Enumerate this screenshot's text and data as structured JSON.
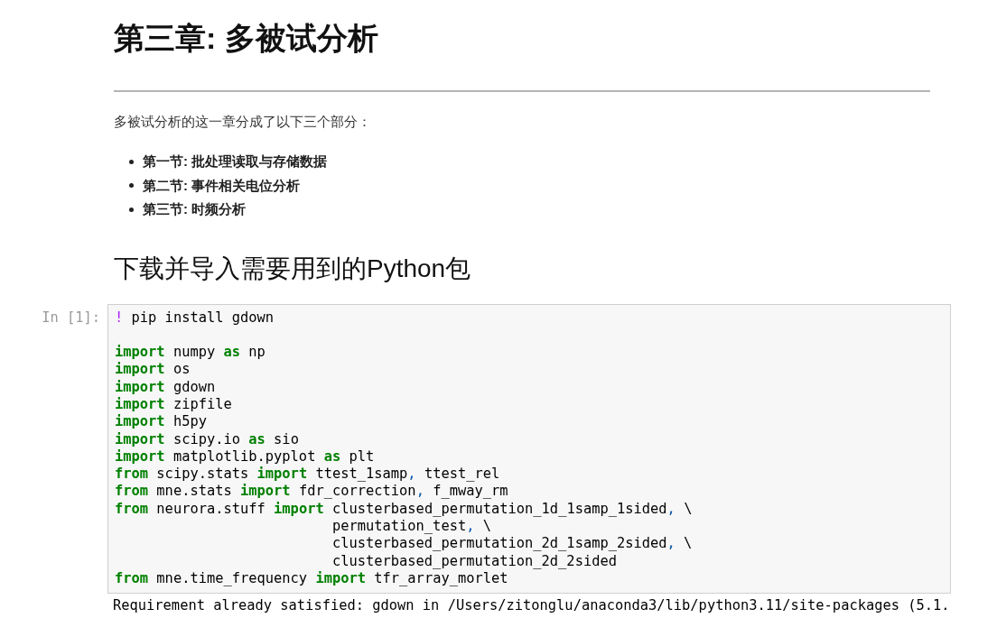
{
  "title": "第三章: 多被试分析",
  "intro": "多被试分析的这一章分成了以下三个部分：",
  "sections": [
    "第一节: 批处理读取与存储数据",
    "第二节: 事件相关电位分析",
    "第三节: 时频分析"
  ],
  "subheading": "下载并导入需要用到的Python包",
  "cell": {
    "prompt": "In [1]:",
    "lines": [
      {
        "kind": "code",
        "tokens": [
          {
            "kind": "magic",
            "text": "!"
          },
          {
            "kind": "name",
            "text": " pip install gdown"
          }
        ]
      },
      {
        "kind": "blank"
      },
      {
        "kind": "code",
        "tokens": [
          {
            "kind": "keyword",
            "text": "import"
          },
          {
            "kind": "name",
            "text": " numpy "
          },
          {
            "kind": "keyword",
            "text": "as"
          },
          {
            "kind": "name",
            "text": " np"
          }
        ]
      },
      {
        "kind": "code",
        "tokens": [
          {
            "kind": "keyword",
            "text": "import"
          },
          {
            "kind": "name",
            "text": " os"
          }
        ]
      },
      {
        "kind": "code",
        "tokens": [
          {
            "kind": "keyword",
            "text": "import"
          },
          {
            "kind": "name",
            "text": " gdown"
          }
        ]
      },
      {
        "kind": "code",
        "tokens": [
          {
            "kind": "keyword",
            "text": "import"
          },
          {
            "kind": "name",
            "text": " zipfile"
          }
        ]
      },
      {
        "kind": "code",
        "tokens": [
          {
            "kind": "keyword",
            "text": "import"
          },
          {
            "kind": "name",
            "text": " h5py"
          }
        ]
      },
      {
        "kind": "code",
        "tokens": [
          {
            "kind": "keyword",
            "text": "import"
          },
          {
            "kind": "name",
            "text": " scipy.io "
          },
          {
            "kind": "keyword",
            "text": "as"
          },
          {
            "kind": "name",
            "text": " sio"
          }
        ]
      },
      {
        "kind": "code",
        "tokens": [
          {
            "kind": "keyword",
            "text": "import"
          },
          {
            "kind": "name",
            "text": " matplotlib.pyplot "
          },
          {
            "kind": "keyword",
            "text": "as"
          },
          {
            "kind": "name",
            "text": " plt"
          }
        ]
      },
      {
        "kind": "code",
        "tokens": [
          {
            "kind": "keyword",
            "text": "from"
          },
          {
            "kind": "name",
            "text": " scipy.stats "
          },
          {
            "kind": "keyword",
            "text": "import"
          },
          {
            "kind": "name",
            "text": " ttest_1samp"
          },
          {
            "kind": "punct",
            "text": ","
          },
          {
            "kind": "name",
            "text": " ttest_rel"
          }
        ]
      },
      {
        "kind": "code",
        "tokens": [
          {
            "kind": "keyword",
            "text": "from"
          },
          {
            "kind": "name",
            "text": " mne.stats "
          },
          {
            "kind": "keyword",
            "text": "import"
          },
          {
            "kind": "name",
            "text": " fdr_correction"
          },
          {
            "kind": "punct",
            "text": ","
          },
          {
            "kind": "name",
            "text": " f_mway_rm"
          }
        ]
      },
      {
        "kind": "code",
        "tokens": [
          {
            "kind": "keyword",
            "text": "from"
          },
          {
            "kind": "name",
            "text": " neurora.stuff "
          },
          {
            "kind": "keyword",
            "text": "import"
          },
          {
            "kind": "name",
            "text": " clusterbased_permutation_1d_1samp_1sided"
          },
          {
            "kind": "punct",
            "text": ","
          },
          {
            "kind": "name",
            "text": " \\"
          }
        ]
      },
      {
        "kind": "code",
        "tokens": [
          {
            "kind": "name",
            "text": "                          permutation_test"
          },
          {
            "kind": "punct",
            "text": ","
          },
          {
            "kind": "name",
            "text": " \\"
          }
        ]
      },
      {
        "kind": "code",
        "tokens": [
          {
            "kind": "name",
            "text": "                          clusterbased_permutation_2d_1samp_2sided"
          },
          {
            "kind": "punct",
            "text": ","
          },
          {
            "kind": "name",
            "text": " \\"
          }
        ]
      },
      {
        "kind": "code",
        "tokens": [
          {
            "kind": "name",
            "text": "                          clusterbased_permutation_2d_2sided"
          }
        ]
      },
      {
        "kind": "code",
        "tokens": [
          {
            "kind": "keyword",
            "text": "from"
          },
          {
            "kind": "name",
            "text": " mne.time_frequency "
          },
          {
            "kind": "keyword",
            "text": "import"
          },
          {
            "kind": "name",
            "text": " tfr_array_morlet"
          }
        ]
      }
    ]
  },
  "output": "Requirement already satisfied: gdown in /Users/zitonglu/anaconda3/lib/python3.11/site-packages (5.1."
}
